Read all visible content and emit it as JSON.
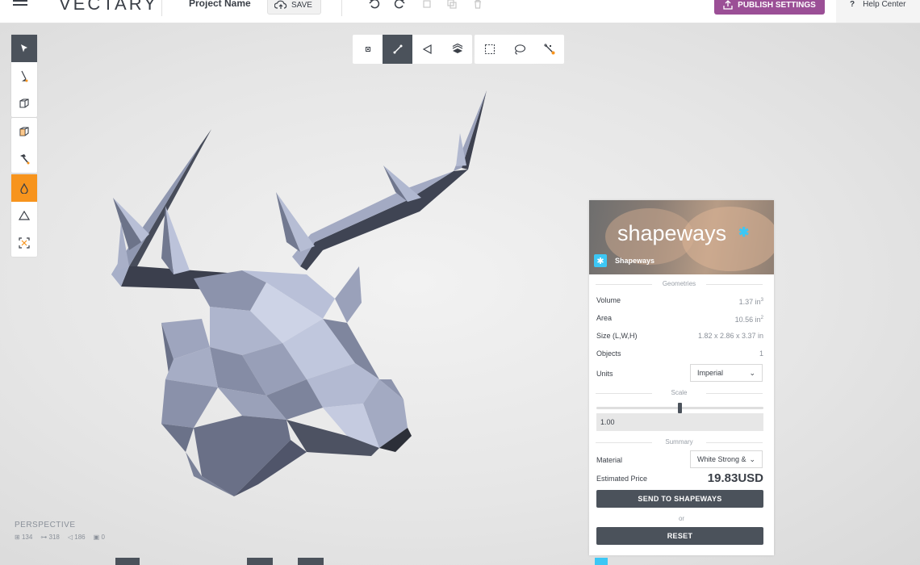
{
  "topbar": {
    "logo": "VECTARY",
    "project_name": "Project Name",
    "save_label": "SAVE",
    "publish_label": "PUBLISH SETTINGS",
    "help_label": "Help Center",
    "help_glyph": "?"
  },
  "left_toolbar": {
    "groups": [
      [
        "select-arrow-icon",
        "pen-icon",
        "cube-icon"
      ],
      [
        "cube-edit-icon",
        "hammer-icon"
      ],
      [
        "drop-icon",
        "triangle-icon",
        "transform-icon"
      ]
    ],
    "active_dark": "select-arrow-icon",
    "active_orange": "drop-icon"
  },
  "center_toolbar": {
    "icons": [
      "vertex-mode-icon",
      "edge-mode-icon",
      "face-mode-icon",
      "object-mode-icon",
      "rect-select-icon",
      "lasso-select-icon",
      "magic-select-icon"
    ],
    "active": "edge-mode-icon"
  },
  "viewport": {
    "view_label": "PERSPECTIVE",
    "stats": [
      {
        "icon": "vertex-count-icon",
        "value": "134"
      },
      {
        "icon": "edge-count-icon",
        "value": "318"
      },
      {
        "icon": "face-count-icon",
        "value": "186"
      },
      {
        "icon": "object-count-icon",
        "value": "0"
      }
    ]
  },
  "panel": {
    "brand": "shapeways",
    "badge_label": "Shapeways",
    "geometries_label": "Geometries",
    "rows": [
      {
        "label": "Volume",
        "value": "1.37 in",
        "sup": "3"
      },
      {
        "label": "Area",
        "value": "10.56 in",
        "sup": "2"
      },
      {
        "label": "Size (L,W,H)",
        "value": "1.82 x 2.86 x 3.37 in",
        "sup": ""
      },
      {
        "label": "Objects",
        "value": "1",
        "sup": ""
      }
    ],
    "units_label": "Units",
    "units_value": "Imperial",
    "scale_label": "Scale",
    "scale_slider": 0.5,
    "scale_value": "1.00",
    "summary_label": "Summary",
    "material_label": "Material",
    "material_value": "White Strong &",
    "price_label": "Estimated Price",
    "price_value": "19.83USD",
    "send_label": "SEND TO SHAPEWAYS",
    "or_label": "or",
    "reset_label": "RESET",
    "accent": "#3cc7f5"
  },
  "colors": {
    "publish": "#9b4f96",
    "dark": "#4b525b",
    "orange": "#f7941d"
  }
}
